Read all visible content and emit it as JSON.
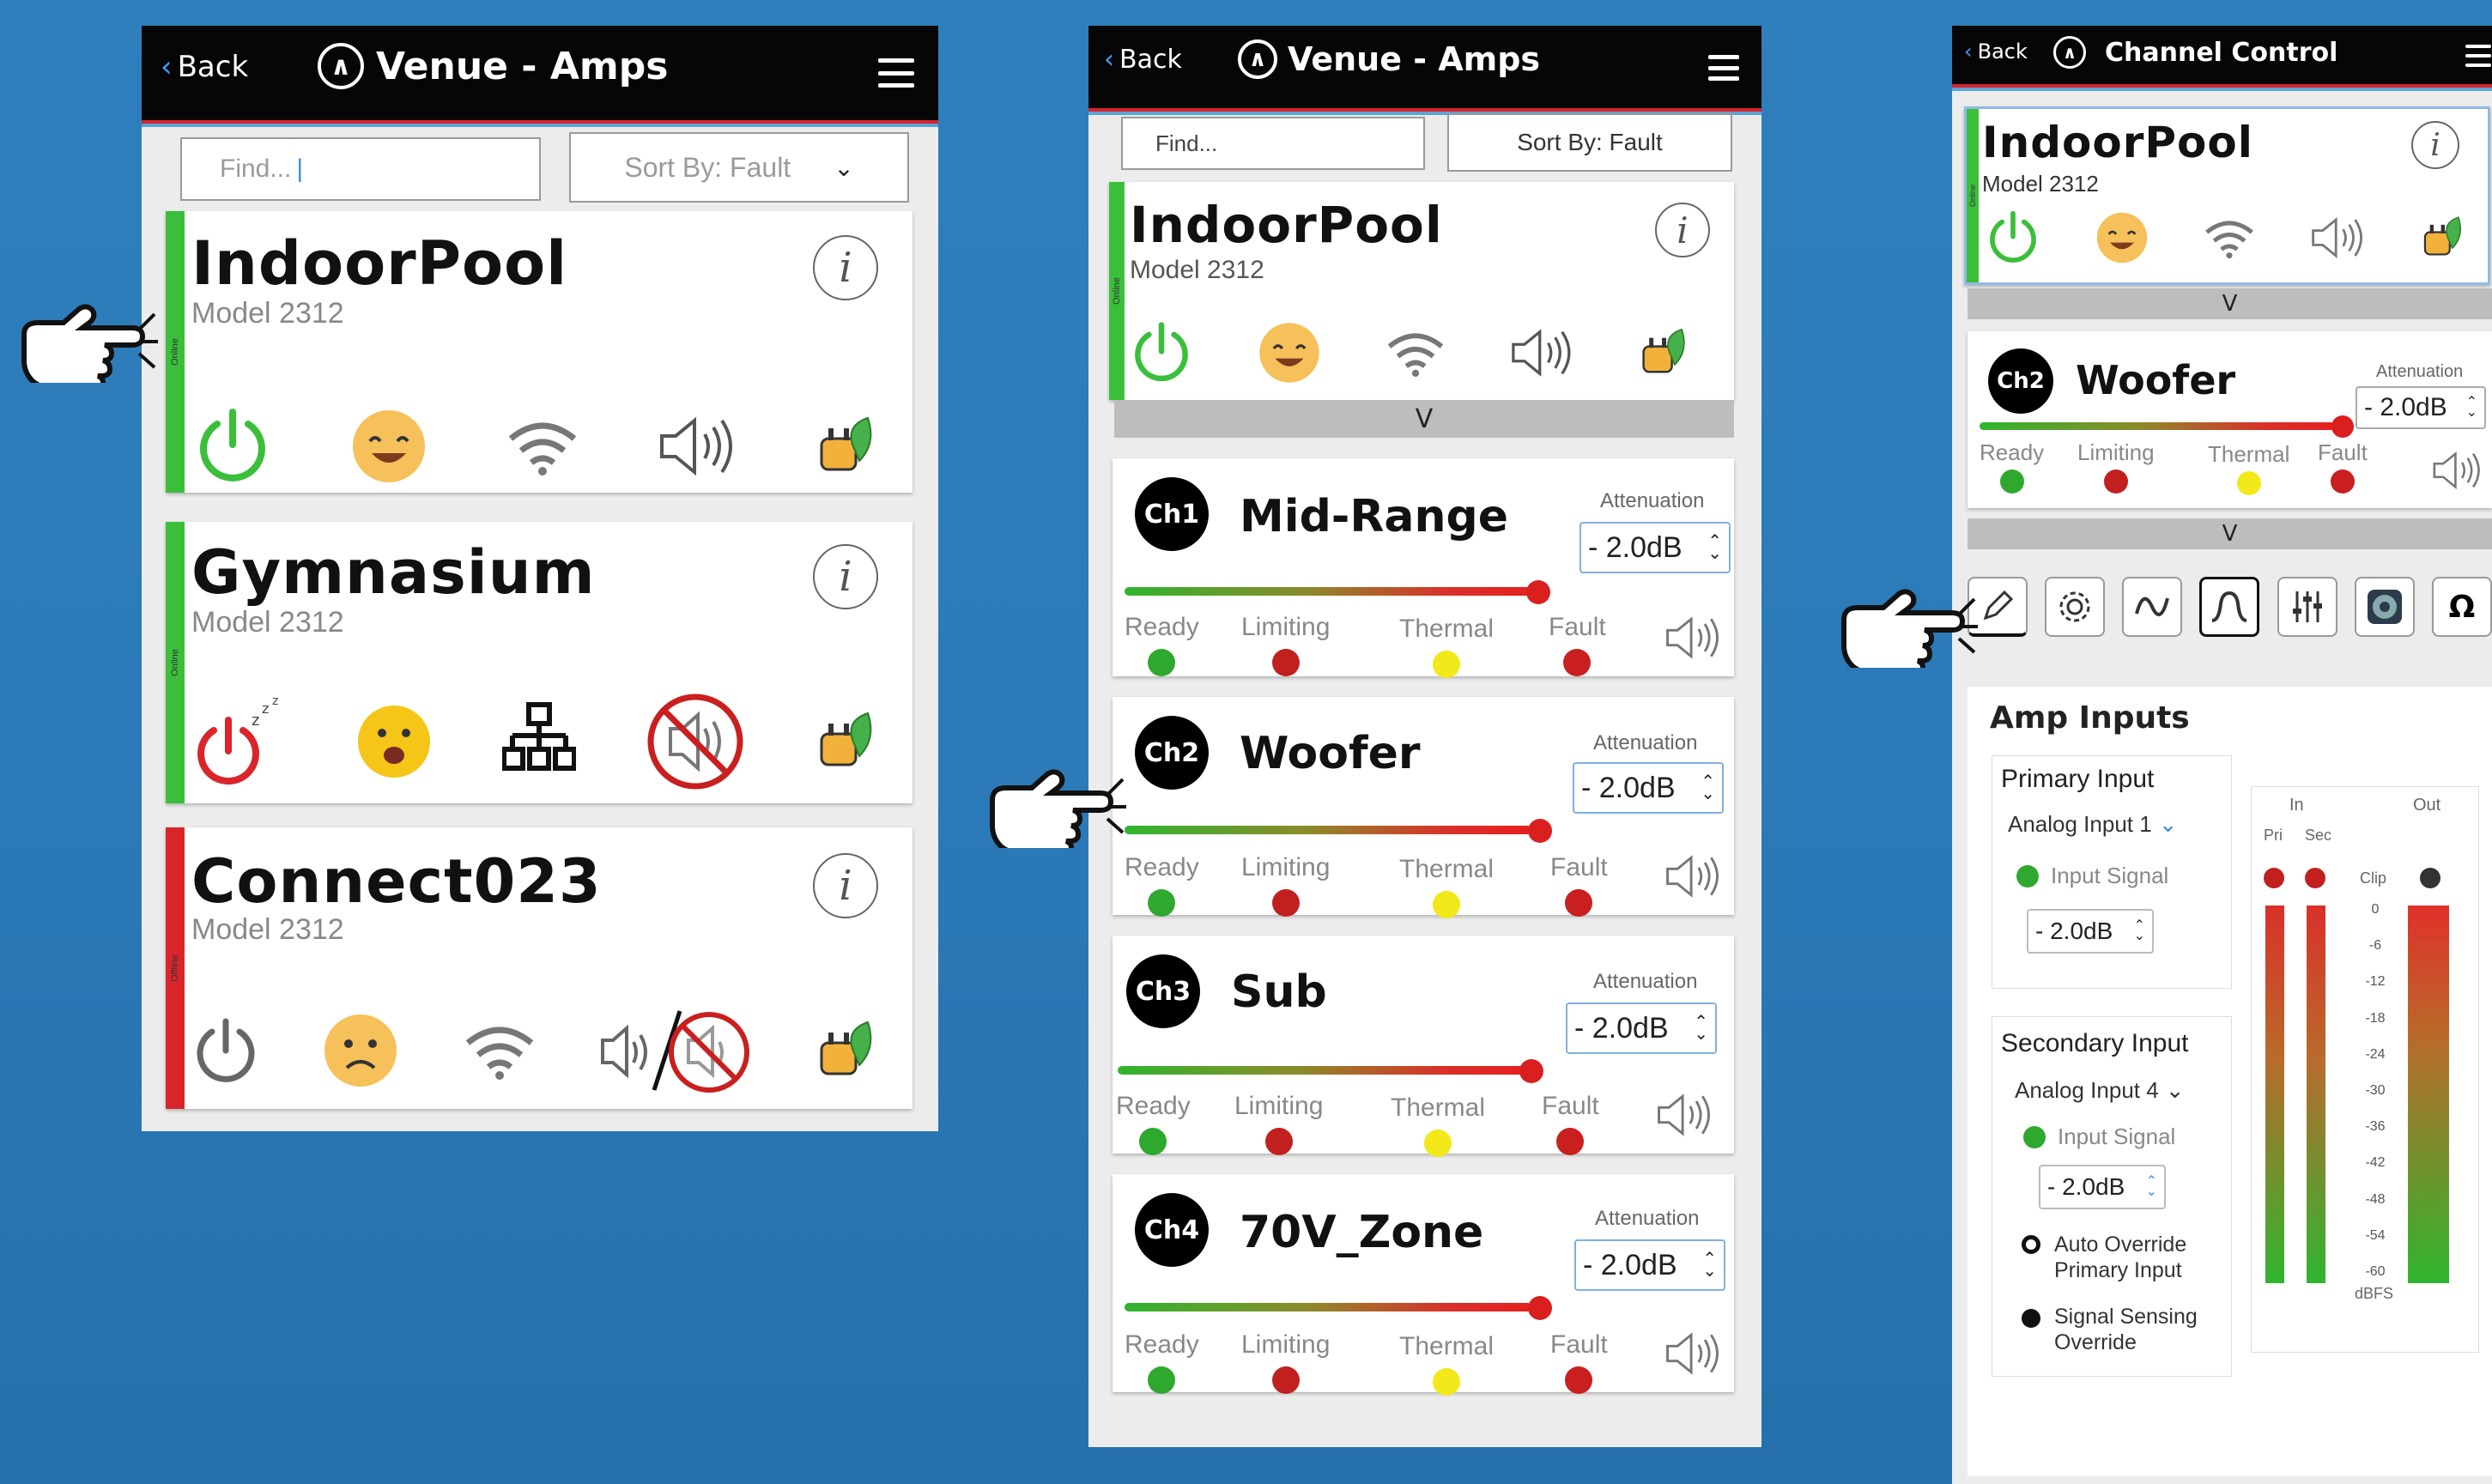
{
  "colors": {
    "online": "#3bbf3b",
    "offline": "#d9252a",
    "ready": "#2fa82f",
    "limiting": "#c21f1f",
    "thermal": "#f2e81a",
    "fault": "#c91f1f"
  },
  "screen1": {
    "back": "Back",
    "title": "Venue - Amps",
    "find_placeholder": "Find...",
    "sort": "Sort By: Fault",
    "devices": [
      {
        "name": "IndoorPool",
        "model": "Model 2312",
        "status": "Online"
      },
      {
        "name": "Gymnasium",
        "model": "Model 2312",
        "status": "Online"
      },
      {
        "name": "Connect023",
        "model": "Model 2312",
        "status": "Offline"
      }
    ]
  },
  "screen2": {
    "back": "Back",
    "title": "Venue - Amps",
    "find_placeholder": "Find...",
    "sort": "Sort By: Fault",
    "device": {
      "name": "IndoorPool",
      "model": "Model 2312",
      "status": "Online"
    },
    "expand": "V",
    "attenuation_label": "Attenuation",
    "status_labels": [
      "Ready",
      "Limiting",
      "Thermal",
      "Fault"
    ],
    "channels": [
      {
        "badge": "Ch1",
        "name": "Mid-Range",
        "att": "- 2.0dB"
      },
      {
        "badge": "Ch2",
        "name": "Woofer",
        "att": "- 2.0dB"
      },
      {
        "badge": "Ch3",
        "name": "Sub",
        "att": "- 2.0dB"
      },
      {
        "badge": "Ch4",
        "name": "70V_Zone",
        "att": "- 2.0dB"
      }
    ]
  },
  "screen3": {
    "back": "Back",
    "title": "Channel Control",
    "device": {
      "name": "IndoorPool",
      "model": "Model 2312",
      "status": "Online"
    },
    "expand": "V",
    "channel": {
      "badge": "Ch2",
      "name": "Woofer",
      "att_label": "Attenuation",
      "att": "- 2.0dB"
    },
    "status_labels": [
      "Ready",
      "Limiting",
      "Thermal",
      "Fault"
    ],
    "section_title": "Amp Inputs",
    "primary": {
      "title": "Primary Input",
      "select": "Analog Input 1",
      "signal": "Input Signal",
      "level": "- 2.0dB"
    },
    "secondary": {
      "title": "Secondary Input",
      "select": "Analog Input 4",
      "signal": "Input Signal",
      "level": "- 2.0dB"
    },
    "options": [
      "Auto Override Primary Input",
      "Signal Sensing Override"
    ],
    "meter": {
      "in": "In",
      "out": "Out",
      "pri": "Pri",
      "sec": "Sec",
      "clip": "Clip",
      "unit": "dBFS",
      "ticks": [
        "0",
        "-6",
        "-12",
        "-18",
        "-24",
        "-30",
        "-36",
        "-42",
        "-48",
        "-54",
        "-60"
      ]
    }
  }
}
